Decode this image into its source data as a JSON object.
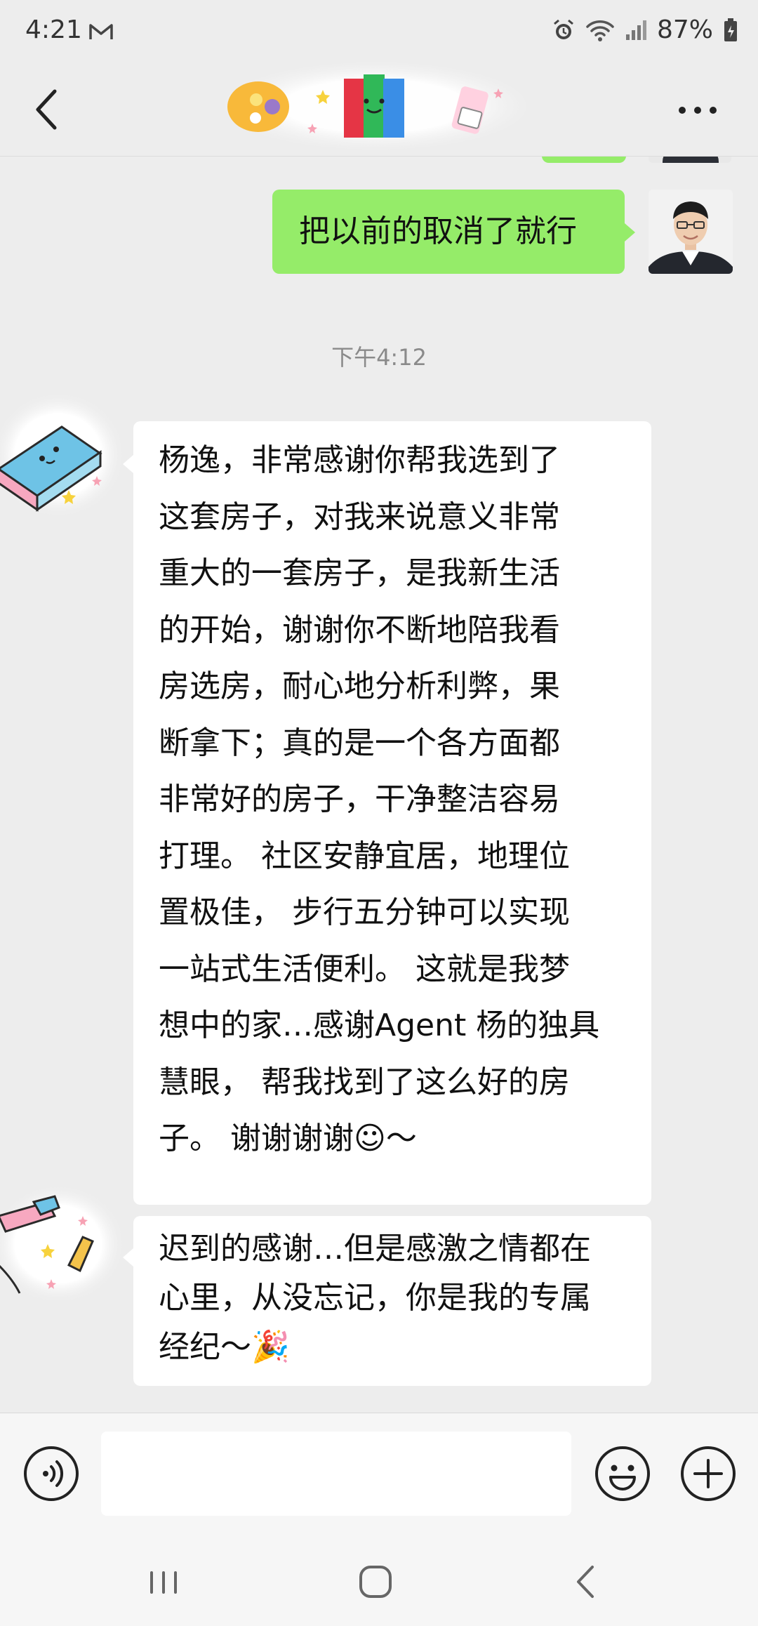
{
  "status_bar": {
    "time": "4:21",
    "battery": "87%"
  },
  "header": {
    "back_label": "back",
    "more_label": "more"
  },
  "messages": [
    {
      "side": "right",
      "text": "把以前的取消了就行"
    },
    {
      "side": "left",
      "text": "杨逸，非常感谢你帮我选到了\n这套房子，对我来说意义非常\n重大的一套房子，是我新生活\n的开始，谢谢你不断地陪我看\n房选房，耐心地分析利弊，果\n断拿下；真的是一个各方面都\n非常好的房子，干净整洁容易\n打理。 社区安静宜居，地理位\n置极佳， 步行五分钟可以实现\n一站式生活便利。 这就是我梦\n想中的家…感谢Agent 杨的独具\n慧眼， 帮我找到了这么好的房\n子。 谢谢谢谢☺～"
    },
    {
      "side": "left",
      "text": "迟到的感谢…但是感激之情都在\n心里，从没忘记，你是我的专属\n经纪～🎉"
    }
  ],
  "timestamp": "下午4:12",
  "input": {
    "value": "",
    "placeholder": ""
  },
  "colors": {
    "background": "#ededed",
    "sent_bubble": "#95ec69",
    "received_bubble": "#ffffff"
  },
  "icons": [
    "gmail-icon",
    "alarm-icon",
    "wifi-icon",
    "signal-icon",
    "battery-icon",
    "back-icon",
    "more-icon",
    "voice-icon",
    "emoji-icon",
    "plus-icon",
    "recent-apps-icon",
    "home-icon",
    "nav-back-icon"
  ]
}
